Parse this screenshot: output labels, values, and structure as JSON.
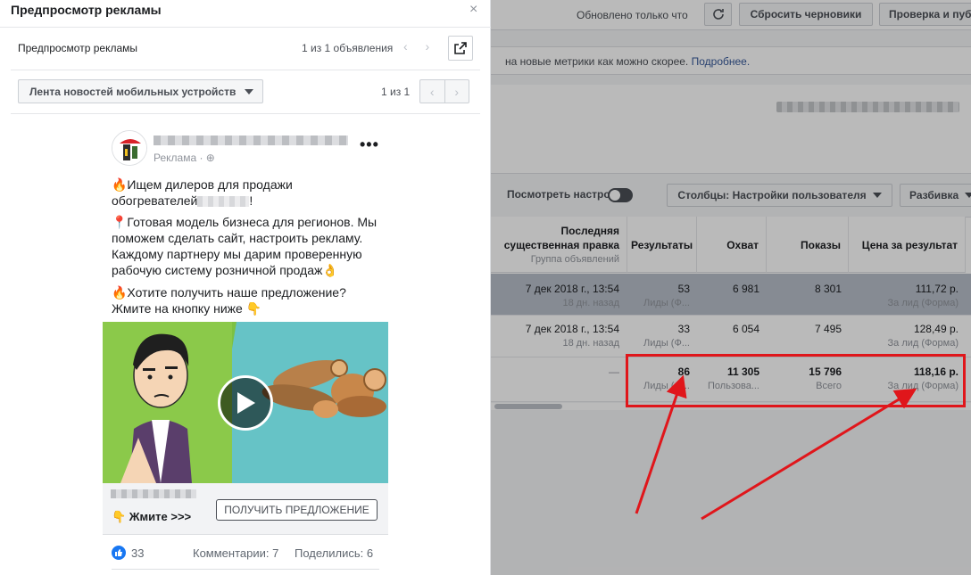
{
  "topbar": {
    "updated_text": "Обновлено только что",
    "reset_label": "Сбросить черновики",
    "review_label": "Проверка и пуб"
  },
  "notice": {
    "text": "на новые метрики как можно скорее.",
    "link": "Подробнее."
  },
  "toolbar": {
    "view_settings": "Посмотреть настройки",
    "columns_label": "Столбцы: Настройки пользователя",
    "breakdown_label": "Разбивка"
  },
  "table": {
    "headers": {
      "last_edit": "Последняя",
      "last_edit2": "существенная правка",
      "last_edit_sub": "Группа объявлений",
      "results": "Результаты",
      "reach": "Охват",
      "impressions": "Показы",
      "cost": "Цена за результат"
    },
    "rows": [
      {
        "date": "7 дек 2018 г., 13:54",
        "ago": "18 дн. назад",
        "results": "53",
        "results_sub": "Лиды (Ф...",
        "reach": "6 981",
        "impressions": "8 301",
        "cost": "111,72 р.",
        "cost_sub": "За лид (Форма)"
      },
      {
        "date": "7 дек 2018 г., 13:54",
        "ago": "18 дн. назад",
        "results": "33",
        "results_sub": "Лиды (Ф...",
        "reach": "6 054",
        "impressions": "7 495",
        "cost": "128,49 р.",
        "cost_sub": "За лид (Форма)"
      }
    ],
    "total": {
      "date": "—",
      "results": "86",
      "results_sub": "Лиды (Ф...",
      "reach": "11 305",
      "reach_sub": "Пользова...",
      "impressions": "15 796",
      "impressions_sub": "Всего",
      "cost": "118,16 р.",
      "cost_sub": "За лид (Форма)"
    }
  },
  "modal": {
    "title": "Предпросмотр рекламы",
    "close": "×",
    "subtitle": "Предпросмотр рекламы",
    "ad_count": "1 из 1 объявления",
    "nav": "‹ ›",
    "placement": "Лента новостей мобильных устройств",
    "placement_count": "1 из 1",
    "pager_prev": "‹",
    "pager_next": "›"
  },
  "post": {
    "sponsored": "Реклама · ⊕",
    "more": "•••",
    "p1a": "🔥Ищем дилеров для продажи",
    "p1b": "обогревателей",
    "p1c": "!",
    "p2": "📍Готовая модель бизнеса для регионов. Мы поможем сделать сайт, настроить рекламу. Каждому партнеру мы дарим проверенную рабочую систему розничной продаж👌",
    "p3": "🔥Хотите получить наше предложение? Жмите на кнопку ниже 👇",
    "cta_text": "👇 Жмите >>>",
    "cta_button": "ПОЛУЧИТЬ ПРЕДЛОЖЕНИЕ",
    "likes": "33",
    "comments": "Комментарии: 7",
    "shares": "Поделились: 6"
  },
  "colors": {
    "highlight": "#e0161b",
    "link": "#365899",
    "like": "#1877f2"
  }
}
